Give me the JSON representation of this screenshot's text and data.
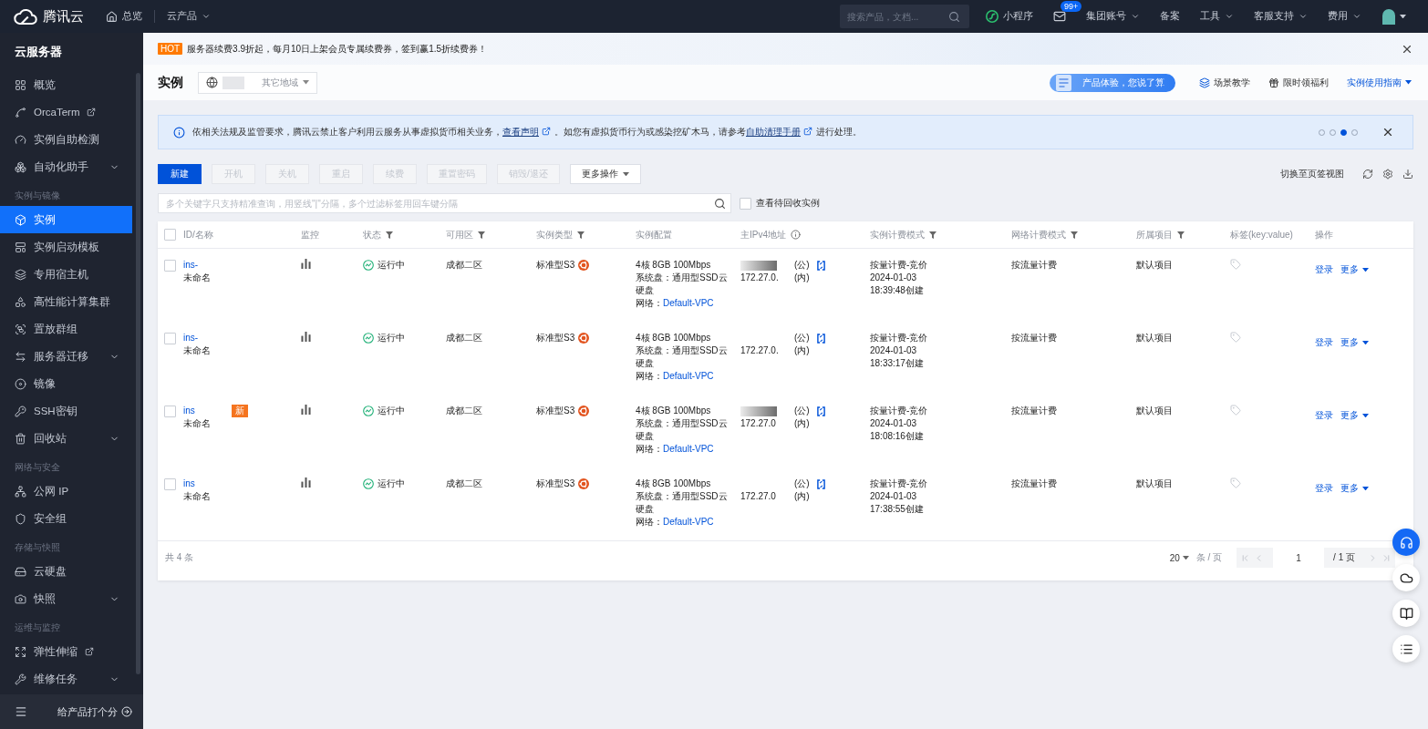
{
  "top_bar": {
    "logo": "腾讯云",
    "nav": [
      {
        "label": "总览",
        "kind": "home"
      },
      {
        "label": "云产品",
        "kind": "dropdown"
      }
    ],
    "search": {
      "placeholder": "搜索产品，文档..."
    },
    "items": [
      {
        "kind": "mini_program",
        "label": "小程序"
      },
      {
        "kind": "mail",
        "badge": "99+"
      },
      {
        "kind": "dropdown",
        "label": "集团账号"
      },
      {
        "kind": "plain",
        "label": "备案"
      },
      {
        "kind": "dropdown",
        "label": "工具"
      },
      {
        "kind": "dropdown",
        "label": "客服支持"
      },
      {
        "kind": "dropdown",
        "label": "费用"
      },
      {
        "kind": "avatar"
      }
    ]
  },
  "sidebar": {
    "title": "云服务器",
    "groups": [
      {
        "items": [
          {
            "label": "概览",
            "selected": false,
            "external": false,
            "expandable": false
          },
          {
            "label": "OrcaTerm",
            "selected": false,
            "external": true,
            "expandable": false
          },
          {
            "label": "实例自助检测",
            "selected": false,
            "external": false,
            "expandable": false
          },
          {
            "label": "自动化助手",
            "selected": false,
            "external": false,
            "expandable": true
          }
        ]
      },
      {
        "heading": "实例与镜像",
        "items": [
          {
            "label": "实例",
            "selected": true,
            "external": false,
            "expandable": false
          },
          {
            "label": "实例启动模板",
            "selected": false,
            "external": false,
            "expandable": false
          },
          {
            "label": "专用宿主机",
            "selected": false,
            "external": false,
            "expandable": false
          },
          {
            "label": "高性能计算集群",
            "selected": false,
            "external": false,
            "expandable": false
          },
          {
            "label": "置放群组",
            "selected": false,
            "external": false,
            "expandable": false
          },
          {
            "label": "服务器迁移",
            "selected": false,
            "external": false,
            "expandable": true
          },
          {
            "label": "镜像",
            "selected": false,
            "external": false,
            "expandable": false
          },
          {
            "label": "SSH密钥",
            "selected": false,
            "external": false,
            "expandable": false
          },
          {
            "label": "回收站",
            "selected": false,
            "external": false,
            "expandable": true
          }
        ]
      },
      {
        "heading": "网络与安全",
        "items": [
          {
            "label": "公网 IP",
            "selected": false,
            "external": false,
            "expandable": false
          },
          {
            "label": "安全组",
            "selected": false,
            "external": false,
            "expandable": false
          }
        ]
      },
      {
        "heading": "存储与快照",
        "items": [
          {
            "label": "云硬盘",
            "selected": false,
            "external": false,
            "expandable": false
          },
          {
            "label": "快照",
            "selected": false,
            "external": false,
            "expandable": true
          }
        ]
      },
      {
        "heading": "运维与监控",
        "items": [
          {
            "label": "弹性伸缩",
            "selected": false,
            "external": true,
            "expandable": false
          },
          {
            "label": "维修任务",
            "selected": false,
            "external": false,
            "expandable": true
          }
        ]
      }
    ],
    "footer": {
      "label": "给产品打个分"
    }
  },
  "banner": {
    "badge": "HOT",
    "text": "服务器续费3.9折起，每月10日上架会员专属续费券，签到赢1.5折续费券！"
  },
  "page_header": {
    "title": "实例",
    "region": {
      "label": "其它地域"
    },
    "feedback": "产品体验，您说了算",
    "links": [
      {
        "label": "场景教学",
        "kind": "plain"
      },
      {
        "label": "限时领福利",
        "kind": "plain"
      },
      {
        "label": "实例使用指南",
        "kind": "dropdown"
      }
    ]
  },
  "notice": {
    "segments": [
      {
        "kind": "text",
        "text": "依相关法规及监管要求，腾讯云禁止客户利用云服务从事虚拟货币相关业务，"
      },
      {
        "kind": "link",
        "text": "查看声明"
      },
      {
        "kind": "text",
        "text": "。如您有虚拟货币行为或感染挖矿木马，请参考"
      },
      {
        "kind": "link",
        "text": "自助清理手册"
      },
      {
        "kind": "text",
        "text": "进行处理。"
      }
    ],
    "dots": [
      {
        "selected": false
      },
      {
        "selected": false
      },
      {
        "selected": true
      },
      {
        "selected": false
      }
    ]
  },
  "toolbar": {
    "buttons": [
      {
        "label": "新建",
        "kind": "primary",
        "disabled": false
      },
      {
        "label": "开机",
        "kind": "default",
        "disabled": true
      },
      {
        "label": "关机",
        "kind": "default",
        "disabled": true
      },
      {
        "label": "重启",
        "kind": "default",
        "disabled": true
      },
      {
        "label": "续费",
        "kind": "default",
        "disabled": true
      },
      {
        "label": "重置密码",
        "kind": "default",
        "disabled": true
      },
      {
        "label": "销毁/退还",
        "kind": "default",
        "disabled": true
      },
      {
        "label": "更多操作",
        "kind": "dropdown",
        "disabled": false
      }
    ],
    "view_switch": "切换至页签视图"
  },
  "search": {
    "placeholder": "多个关键字只支持精准查询，用竖线\"|\"分隔，多个过滤标签用回车键分隔",
    "recycle": {
      "label": "查看待回收实例",
      "checked": false
    }
  },
  "table": {
    "select_all": {
      "checked": false
    },
    "columns": [
      {
        "label": "ID/名称",
        "filter": false,
        "info": false
      },
      {
        "label": "监控",
        "filter": false,
        "info": false
      },
      {
        "label": "状态",
        "filter": true,
        "info": false
      },
      {
        "label": "可用区",
        "filter": true,
        "info": false
      },
      {
        "label": "实例类型",
        "filter": true,
        "info": false
      },
      {
        "label": "实例配置",
        "filter": false,
        "info": false
      },
      {
        "label": "主IPv4地址",
        "filter": false,
        "info": true
      },
      {
        "label": "实例计费模式",
        "filter": true,
        "info": false
      },
      {
        "label": "网络计费模式",
        "filter": true,
        "info": false
      },
      {
        "label": "所属项目",
        "filter": true,
        "info": false
      },
      {
        "label": "标签(key:value)",
        "filter": false,
        "info": false
      },
      {
        "label": "操作",
        "filter": false,
        "info": false
      }
    ],
    "rows": [
      {
        "checked": false,
        "id": "ins-",
        "name": "未命名",
        "status": "运行中",
        "zone": "成都二区",
        "type": "标准型S3",
        "spec": "4核 8GB 100Mbps",
        "disk": "系统盘：通用型SSD云硬盘",
        "network_label": "网络：",
        "network": "Default-VPC",
        "public_ip_redacted": true,
        "public_ip_tag": "(公)",
        "private_ip": "172.27.0.",
        "private_ip_tag": "(内)",
        "billing": "按量计费-竞价",
        "date": "2024-01-03",
        "created": "18:39:48创建",
        "network_billing": "按流量计费",
        "project": "默认项目",
        "actions": [
          {
            "label": "登录",
            "kind": "link"
          },
          {
            "label": "更多",
            "kind": "dropdown"
          }
        ]
      },
      {
        "checked": false,
        "id": "ins-",
        "name": "未命名",
        "status": "运行中",
        "zone": "成都二区",
        "type": "标准型S3",
        "spec": "4核 8GB 100Mbps",
        "disk": "系统盘：通用型SSD云硬盘",
        "network_label": "网络：",
        "network": "Default-VPC",
        "public_ip_redacted": false,
        "public_ip_tag": "(公)",
        "private_ip": "172.27.0.",
        "private_ip_tag": "(内)",
        "billing": "按量计费-竞价",
        "date": "2024-01-03",
        "created": "18:33:17创建",
        "network_billing": "按流量计费",
        "project": "默认项目",
        "actions": [
          {
            "label": "登录",
            "kind": "link"
          },
          {
            "label": "更多",
            "kind": "dropdown"
          }
        ]
      },
      {
        "checked": false,
        "id": "ins",
        "badge": "新",
        "name": "未命名",
        "status": "运行中",
        "zone": "成都二区",
        "type": "标准型S3",
        "spec": "4核 8GB 100Mbps",
        "disk": "系统盘：通用型SSD云硬盘",
        "network_label": "网络：",
        "network": "Default-VPC",
        "public_ip_redacted": true,
        "public_ip_tag": "(公)",
        "private_ip": "172.27.0",
        "private_ip_tag": "(内)",
        "billing": "按量计费-竞价",
        "date": "2024-01-03",
        "created": "18:08:16创建",
        "network_billing": "按流量计费",
        "project": "默认项目",
        "actions": [
          {
            "label": "登录",
            "kind": "link"
          },
          {
            "label": "更多",
            "kind": "dropdown"
          }
        ]
      },
      {
        "checked": false,
        "id": "ins",
        "name": "未命名",
        "status": "运行中",
        "zone": "成都二区",
        "type": "标准型S3",
        "spec": "4核 8GB 100Mbps",
        "disk": "系统盘：通用型SSD云硬盘",
        "network_label": "网络：",
        "network": "Default-VPC",
        "public_ip_redacted": false,
        "public_ip_tag": "(公)",
        "private_ip": "172.27.0",
        "private_ip_tag": "(内)",
        "billing": "按量计费-竞价",
        "date": "2024-01-03",
        "created": "17:38:55创建",
        "network_billing": "按流量计费",
        "project": "默认项目",
        "actions": [
          {
            "label": "登录",
            "kind": "link"
          },
          {
            "label": "更多",
            "kind": "dropdown"
          }
        ]
      }
    ],
    "footer": {
      "total": "共 4 条",
      "page_size": "20",
      "page_size_unit": "条 / 页",
      "page": "1",
      "page_total": "/ 1 页"
    }
  }
}
